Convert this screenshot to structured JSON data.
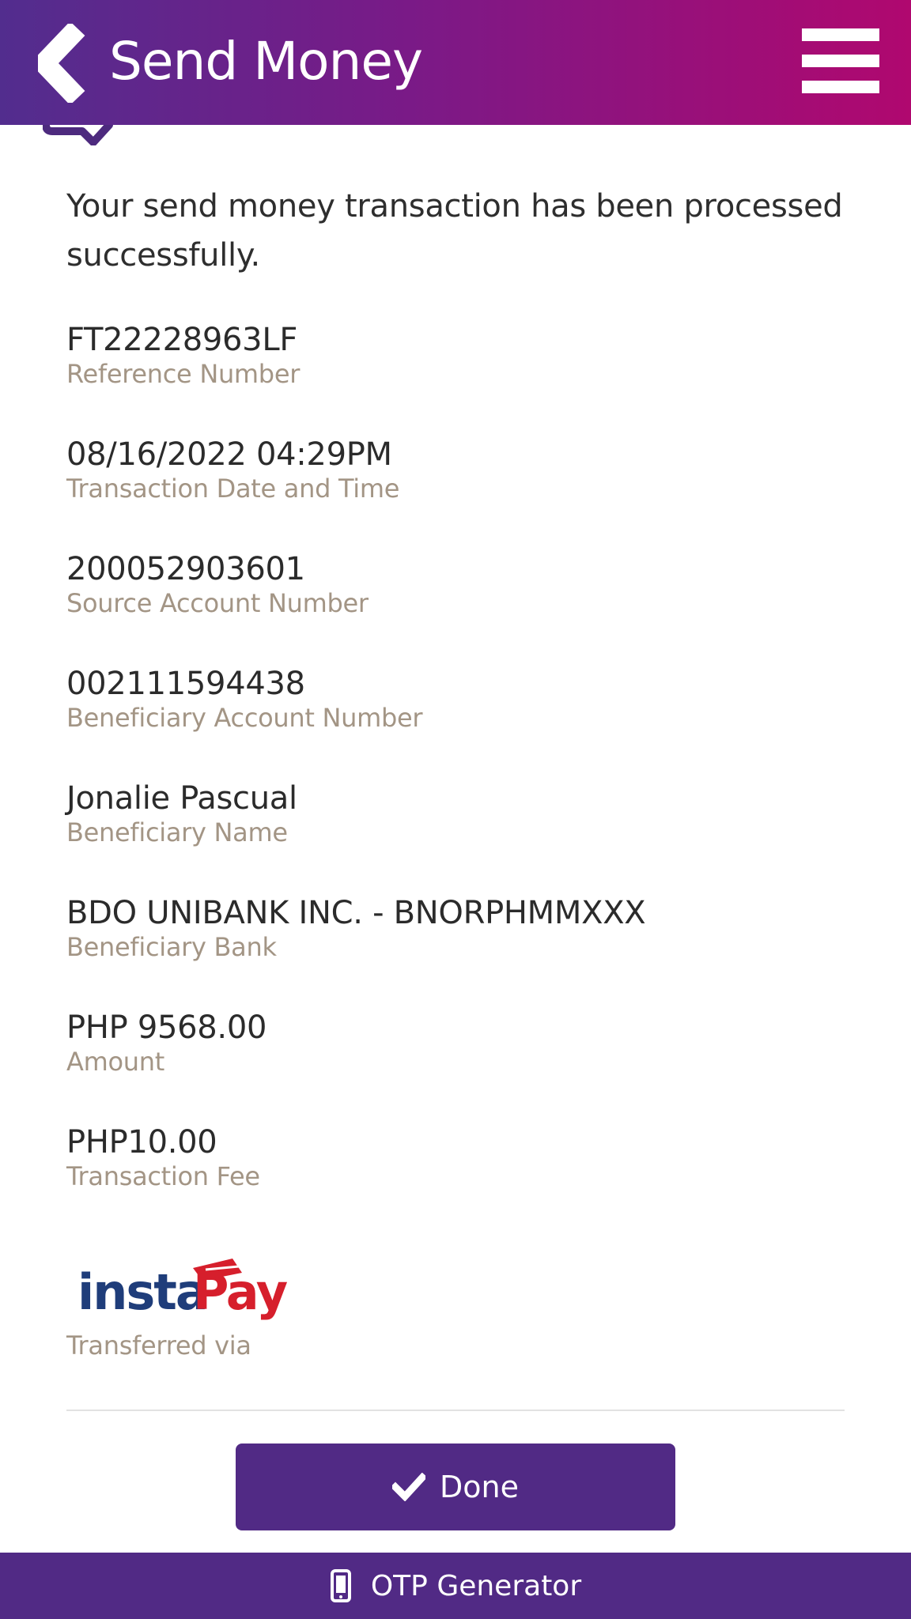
{
  "header": {
    "title": "Send Money",
    "back_icon": "chevron-left-icon",
    "menu_icon": "hamburger-menu-icon"
  },
  "colors": {
    "header_gradient_start": "#522d8e",
    "header_gradient_end": "#b0086f",
    "primary": "#512a85",
    "label": "#a39585"
  },
  "message": "Your send money transaction has been processed successfully.",
  "fields": [
    {
      "value": "FT22228963LF",
      "label": "Reference Number"
    },
    {
      "value": "08/16/2022 04:29PM",
      "label": "Transaction Date and Time"
    },
    {
      "value": "200052903601",
      "label": "Source Account Number"
    },
    {
      "value": "002111594438",
      "label": "Beneficiary Account Number"
    },
    {
      "value": "Jonalie Pascual",
      "label": "Beneficiary Name"
    },
    {
      "value": "BDO UNIBANK INC. - BNORPHMMXXX",
      "label": "Beneficiary Bank"
    },
    {
      "value": "PHP 9568.00",
      "label": "Amount"
    },
    {
      "value": "PHP10.00",
      "label": "Transaction Fee"
    }
  ],
  "transfer": {
    "logo_text": "instaPay",
    "label": "Transferred via"
  },
  "done_button": {
    "label": "Done",
    "icon": "checkmark-icon"
  },
  "footer": {
    "label": "OTP Generator",
    "icon": "mobile-phone-icon"
  }
}
